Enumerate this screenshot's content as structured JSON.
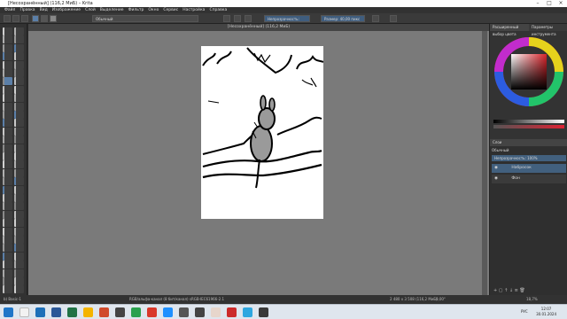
{
  "window": {
    "title": "[Несохранённый] (116,2 MиБ) – Krita"
  },
  "menu": [
    "Файл",
    "Правка",
    "Вид",
    "Изображение",
    "Слой",
    "Выделение",
    "Фильтр",
    "Окно",
    "Сервис",
    "Настройка",
    "Справка"
  ],
  "toolbar": {
    "blend_mode": "Обычный",
    "opacity": "Непрозрачность: 100%",
    "size": "Размер: 40,00 пикс"
  },
  "document_tab": "[Несохранённый] (116,2 MиБ)",
  "dock": {
    "color_tab": "Расширенный выбор цвета",
    "color_tab2": "Параметры инструмента",
    "layers_tab": "Слои",
    "blend_mode": "Обычный",
    "layer_opacity": "Непрозрачность: 100%",
    "layers": [
      {
        "name": "Набросок",
        "selected": true
      },
      {
        "name": "Фон",
        "selected": false
      }
    ],
    "accent": "#42607e"
  },
  "status": {
    "left": "b) Basic-1",
    "middle": "RGB/альфа-канал (8 бит/канал)  sRGB-IEC61966-2.1",
    "right": "2 480 x 3 508 (116,2 MиБ)",
    "rotation": "0,00°",
    "zoom": "18,7%"
  },
  "taskbar": {
    "time": "12:07",
    "date": "30.01.2024",
    "lang": "РУС"
  }
}
